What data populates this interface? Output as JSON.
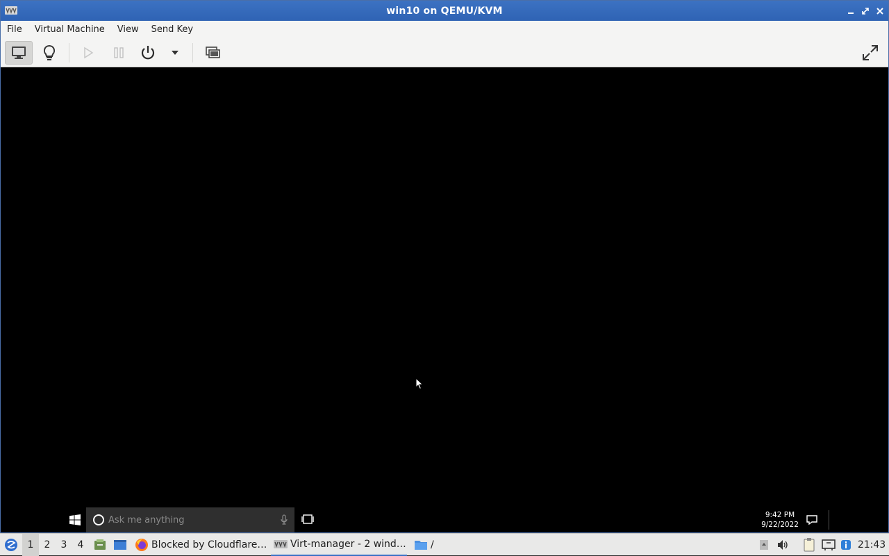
{
  "window": {
    "title": "win10 on QEMU/KVM"
  },
  "menubar": {
    "items": [
      "File",
      "Virtual Machine",
      "View",
      "Send Key"
    ]
  },
  "toolbar": {
    "buttons": [
      "console-icon",
      "details-icon",
      "run-icon",
      "pause-icon",
      "power-icon",
      "power-menu-icon",
      "snapshots-icon",
      "fullscreen-icon"
    ]
  },
  "guest": {
    "search_placeholder": "Ask me anything",
    "time": "9:42 PM",
    "date": "9/22/2022"
  },
  "panel": {
    "workspaces": [
      "1",
      "2",
      "3",
      "4"
    ],
    "active_workspace": "1",
    "tasks": [
      {
        "label": "Blocked by Cloudflare…",
        "icon": "firefox-icon"
      },
      {
        "label": "Virt-manager - 2 wind…",
        "icon": "virt-manager-icon"
      },
      {
        "label": "/",
        "icon": "folder-icon"
      }
    ],
    "clock": "21:43"
  },
  "colors": {
    "titlebar": "#2f63b4",
    "accent": "#3a71c6"
  }
}
